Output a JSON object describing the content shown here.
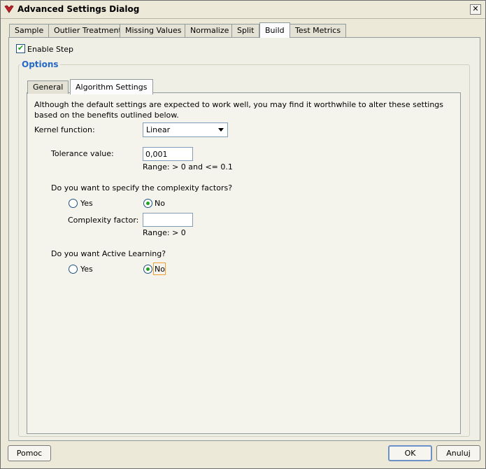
{
  "window": {
    "title": "Advanced Settings Dialog",
    "close_label": "✕"
  },
  "tabs": [
    "Sample",
    "Outlier Treatment",
    "Missing Values",
    "Normalize",
    "Split",
    "Build",
    "Test Metrics"
  ],
  "active_tab": "Build",
  "enable_step": {
    "label": "Enable Step",
    "checked": true
  },
  "options": {
    "title": "Options",
    "inner_tabs": [
      "General",
      "Algorithm Settings"
    ],
    "active_inner_tab": "Algorithm Settings",
    "description": "Although the default settings are expected to work well, you may find it worthwhile to alter these settings based on the benefits outlined below.",
    "kernel": {
      "label": "Kernel function:",
      "value": "Linear"
    },
    "tolerance": {
      "label": "Tolerance value:",
      "value": "0,001",
      "range": "Range: > 0 and <= 0.1"
    },
    "complexity_question": "Do you want to specify the complexity factors?",
    "complexity_yes": "Yes",
    "complexity_no": "No",
    "complexity_selected": "No",
    "complexity_factor": {
      "label": "Complexity factor:",
      "value": "",
      "range": "Range: > 0"
    },
    "active_learning_question": "Do you want Active Learning?",
    "active_yes": "Yes",
    "active_no": "No",
    "active_selected": "No"
  },
  "buttons": {
    "help": "Pomoc",
    "ok": "OK",
    "cancel": "Anuluj"
  }
}
